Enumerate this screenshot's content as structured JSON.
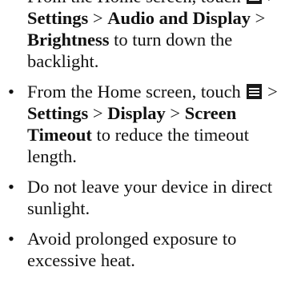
{
  "bullet_char": "•",
  "arrow": ">",
  "items": [
    {
      "intro": "From the Home screen, touch",
      "path": [
        "Settings",
        "Audio and Display",
        "Brightness"
      ],
      "tail": "to turn down the backlight."
    },
    {
      "intro": "From the Home screen, touch",
      "path": [
        "Settings",
        "Display",
        "Screen Timeout"
      ],
      "tail": "to reduce the timeout length."
    },
    {
      "text": "Do not leave your device in direct sunlight."
    },
    {
      "text": "Avoid prolonged exposure to excessive heat."
    }
  ],
  "icons": {
    "menu": "menu-icon"
  }
}
